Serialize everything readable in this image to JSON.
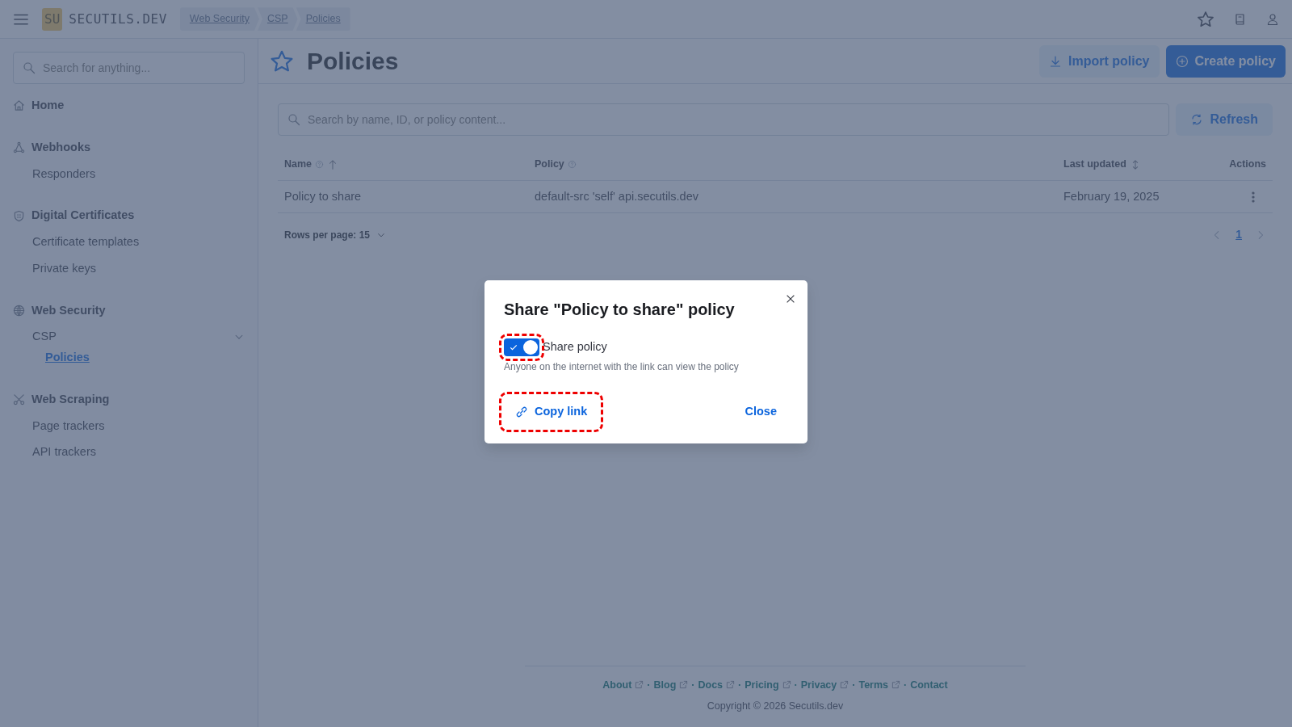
{
  "header": {
    "logo_badge": "SU",
    "logo_text": "SECUTILS.DEV",
    "breadcrumbs": [
      "Web Security",
      "CSP",
      "Policies"
    ]
  },
  "sidebar": {
    "search_placeholder": "Search for anything...",
    "sections": [
      {
        "label": "Home",
        "selected": false
      },
      {
        "label": "Webhooks",
        "selected": false,
        "children": [
          {
            "label": "Responders",
            "selected": false
          }
        ]
      },
      {
        "label": "Digital Certificates",
        "selected": false,
        "children": [
          {
            "label": "Certificate templates",
            "selected": false
          },
          {
            "label": "Private keys",
            "selected": false
          }
        ]
      },
      {
        "label": "Web Security",
        "selected": false,
        "children": [
          {
            "label": "CSP",
            "selected": false,
            "expanded": true,
            "children": [
              {
                "label": "Policies",
                "selected": true
              }
            ]
          }
        ]
      },
      {
        "label": "Web Scraping",
        "selected": false,
        "children": [
          {
            "label": "Page trackers",
            "selected": false
          },
          {
            "label": "API trackers",
            "selected": false
          }
        ]
      }
    ]
  },
  "page": {
    "title": "Policies",
    "actions": [
      {
        "label": "Import policy",
        "kind": "import"
      },
      {
        "label": "Create policy",
        "kind": "create"
      }
    ],
    "search_placeholder": "Search by name, ID, or policy content...",
    "refresh": "Refresh",
    "table": {
      "columns": [
        {
          "label": "Name",
          "help": true,
          "sortable": true,
          "sorted": true
        },
        {
          "label": "Policy",
          "help": true,
          "sortable": false
        },
        {
          "label": "Last updated",
          "help": false,
          "sortable": true,
          "sorted": false
        },
        {
          "label": "Actions",
          "help": false,
          "sortable": false
        }
      ],
      "rows": [
        {
          "cells": [
            "Policy to share",
            "default-src 'self' api.secutils.dev",
            "February 19, 2025"
          ]
        }
      ]
    },
    "rows_per_page": "Rows per page: 15",
    "pages": [
      {
        "label": "1",
        "selected": true
      }
    ]
  },
  "footer": {
    "links": [
      {
        "label": "About",
        "external": true
      },
      {
        "label": "Blog",
        "external": true
      },
      {
        "label": "Docs",
        "external": true
      },
      {
        "label": "Pricing",
        "external": true
      },
      {
        "label": "Privacy",
        "external": true
      },
      {
        "label": "Terms",
        "external": true
      },
      {
        "label": "Contact",
        "external": false
      }
    ],
    "separator": "·",
    "copyright": "Copyright © 2026 Secutils.dev"
  },
  "dialog": {
    "title": "Share \"Policy to share\" policy",
    "toggle": {
      "label": "Share policy",
      "on": true,
      "hint": "Anyone on the internet with the link can view the policy"
    },
    "copy_link": "Copy link",
    "close": "Close"
  }
}
